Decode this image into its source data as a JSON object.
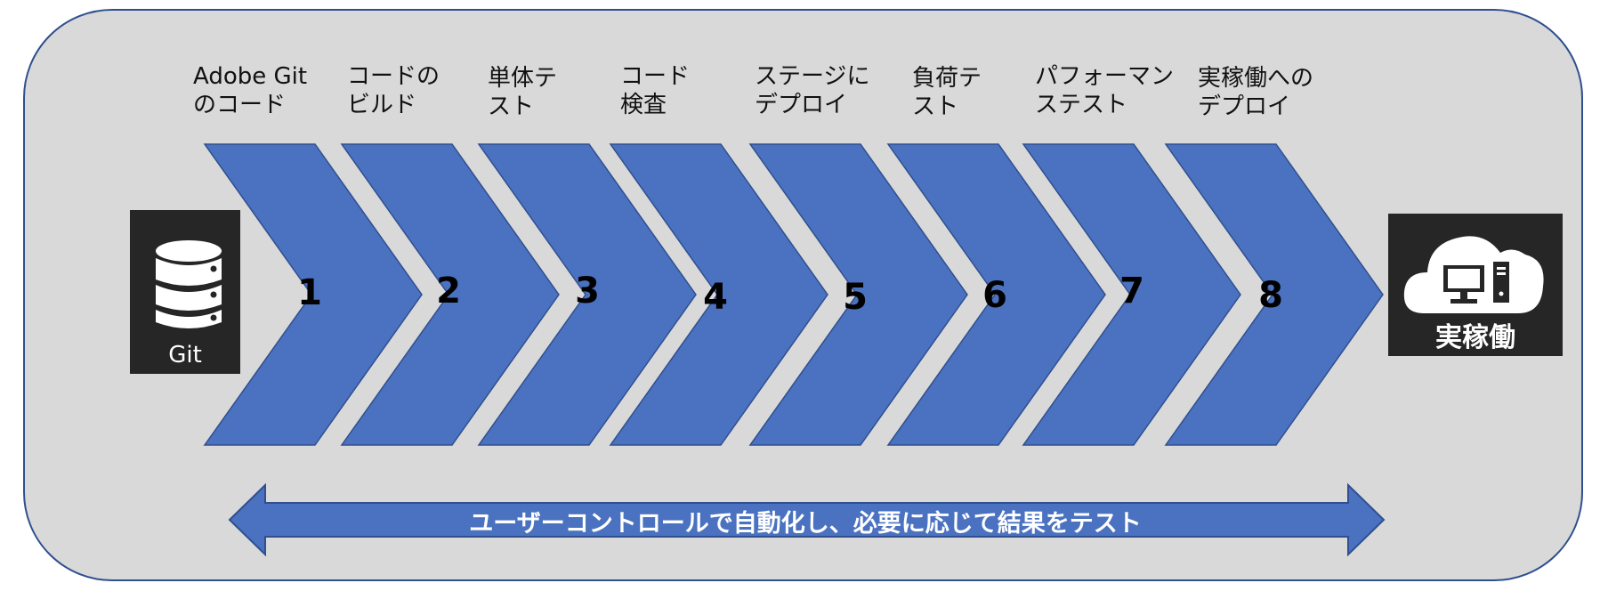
{
  "source": {
    "caption": "Git",
    "icon": "database-icon"
  },
  "steps": [
    {
      "number": "1",
      "label": "Adobe Git\nのコード"
    },
    {
      "number": "2",
      "label": "コードの\nビルド"
    },
    {
      "number": "3",
      "label": "単体テ\nスト"
    },
    {
      "number": "4",
      "label": "コード\n検査"
    },
    {
      "number": "5",
      "label": "ステージに\nデプロイ"
    },
    {
      "number": "6",
      "label": "負荷テ\nスト"
    },
    {
      "number": "7",
      "label": "パフォーマン\nステスト"
    },
    {
      "number": "8",
      "label": "実稼働への\nデプロイ"
    }
  ],
  "destination": {
    "caption": "実稼働",
    "icon": "cloud-computer-icon"
  },
  "bottom_arrow": {
    "text": "ユーザーコントロールで自動化し、必要に応じて結果をテスト"
  },
  "colors": {
    "chevron_fill": "#4a72c0",
    "chevron_stroke": "#2f4f8f",
    "panel_bg": "#d9d9d9",
    "icon_box": "#262626"
  }
}
